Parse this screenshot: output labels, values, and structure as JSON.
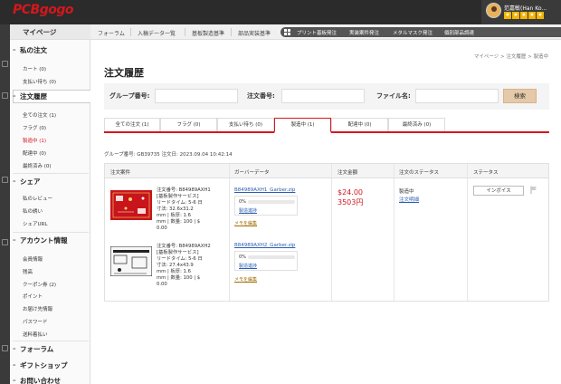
{
  "brand": {
    "logo_text": "PCBgogo",
    "accent": "#d4171d"
  },
  "user": {
    "name": "范嘉敏(Han Ko...",
    "stars": "★★★★★"
  },
  "nav": {
    "items": [
      "フォーラム",
      "入稿データ一覧",
      "基板製造基準",
      "部品実装基準"
    ],
    "dark_items": [
      "プリント基板発注",
      "実装案件発注",
      "メタルマスク発注",
      "個別部品調達"
    ]
  },
  "sidebar": {
    "top": "マイページ",
    "sections": [
      {
        "title": "私の注文",
        "items": [
          "カート (0)",
          "支払い待ち (0)"
        ]
      },
      {
        "title": "注文履歴",
        "items": [
          "全ての注文 (1)",
          "フラグ (0)",
          "製造中 (1)",
          "配達中 (0)",
          "最終済み (0)"
        ]
      },
      {
        "title": "シェア",
        "items": [
          "私のレビュー",
          "私の誘い",
          "シェアURL"
        ]
      },
      {
        "title": "アカウント情報",
        "items": [
          "会員情報",
          "残高",
          "クーポン券 (2)",
          "ポイント",
          "お届け先情報",
          "パスワード",
          "送料着払い"
        ]
      },
      {
        "title": "フォーラム",
        "items": []
      },
      {
        "title": "ギフトショップ",
        "items": []
      },
      {
        "title": "お問い合わせ",
        "items": []
      }
    ]
  },
  "breadcrumb": "マイページ > 注文履歴 > 製造中",
  "page_title": "注文履歴",
  "search": {
    "group_label": "グループ番号:",
    "order_label": "注文番号:",
    "file_label": "ファイル名:",
    "button": "検索"
  },
  "tabs": [
    "全ての注文 (1)",
    "フラグ (0)",
    "支払い待ち (0)",
    "製造中 (1)",
    "配達中 (0)",
    "最終済み (0)"
  ],
  "active_tab_index": 3,
  "group_line": "グループ番号: GB39735 注文日: 2023.09.04 10:42:14",
  "table": {
    "headers": [
      "注文案件",
      "ガーバーデータ",
      "注文金額",
      "注文のステータス",
      "ステータス"
    ],
    "price": "$24.00",
    "price_jpy": "3503円",
    "status": "製造中",
    "status_link": "注文明細",
    "invoice": "インボイス",
    "rows": [
      {
        "order_no": "注文番号: B84989AXH1",
        "service": "[基板製作サービス]",
        "lead": "リードタイム: 5-6 日",
        "size": "寸法: 32.6x31.2",
        "spec": "mm | 板厚: 1.6",
        "qty": "mm | 数量: 100 | $",
        "amt": "0.00",
        "gerber": "B84989AXH1_Garber.zip",
        "progress_text": "0%",
        "progress": 0,
        "prog_link": "製造進捗",
        "memo": "メモを編集"
      },
      {
        "order_no": "注文番号: B84989AXH2",
        "service": "[基板製作サービス]",
        "lead": "リードタイム: 5-6 日",
        "size": "寸法: 27.4x43.9",
        "spec": "mm | 板厚: 1.6",
        "qty": "mm | 数量: 100 | $",
        "amt": "0.00",
        "gerber": "B84989AXH2_Garber.zip",
        "progress_text": "0%",
        "progress": 0,
        "prog_link": "製造進捗",
        "memo": "メモを編集"
      }
    ]
  }
}
